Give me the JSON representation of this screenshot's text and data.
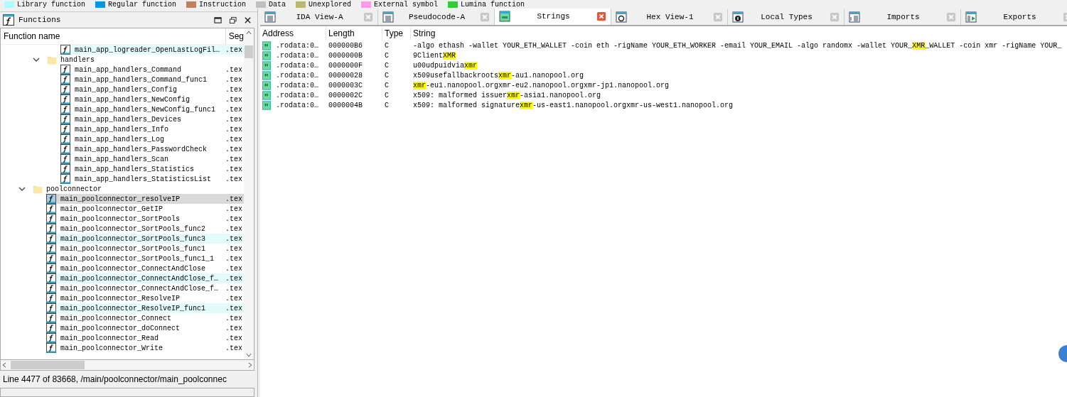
{
  "legend": [
    {
      "label": "Library function",
      "color": "#aaffff"
    },
    {
      "label": "Regular function",
      "color": "#0099dd"
    },
    {
      "label": "Instruction",
      "color": "#c08060"
    },
    {
      "label": "Data",
      "color": "#c0c0c0"
    },
    {
      "label": "Unexplored",
      "color": "#b8b870"
    },
    {
      "label": "External symbol",
      "color": "#ff99ee"
    },
    {
      "label": "Lumina function",
      "color": "#33cc33"
    }
  ],
  "functions_panel": {
    "title": "Functions",
    "columns": [
      "Function name",
      "Seg"
    ],
    "tree": [
      {
        "kind": "scrolled_folder",
        "children": [
          {
            "kind": "scrolled_folder",
            "children": [
              {
                "kind": "function",
                "name": "main_app_logreader_OpenLastLogFil…",
                "segment": ".tex",
                "highlighted": true,
                "selected": false
              }
            ]
          },
          {
            "kind": "folder",
            "name": "handlers",
            "expanded": true,
            "children": [
              {
                "kind": "function",
                "name": "main_app_handlers_Command",
                "segment": ".tex",
                "highlighted": false,
                "selected": false
              },
              {
                "kind": "function",
                "name": "main_app_handlers_Command_func1",
                "segment": ".tex",
                "highlighted": false,
                "selected": false
              },
              {
                "kind": "function",
                "name": "main_app_handlers_Config",
                "segment": ".tex",
                "highlighted": false,
                "selected": false
              },
              {
                "kind": "function",
                "name": "main_app_handlers_NewConfig",
                "segment": ".tex",
                "highlighted": false,
                "selected": false
              },
              {
                "kind": "function",
                "name": "main_app_handlers_NewConfig_func1",
                "segment": ".tex",
                "highlighted": false,
                "selected": false
              },
              {
                "kind": "function",
                "name": "main_app_handlers_Devices",
                "segment": ".tex",
                "highlighted": false,
                "selected": false
              },
              {
                "kind": "function",
                "name": "main_app_handlers_Info",
                "segment": ".tex",
                "highlighted": false,
                "selected": false
              },
              {
                "kind": "function",
                "name": "main_app_handlers_Log",
                "segment": ".tex",
                "highlighted": false,
                "selected": false
              },
              {
                "kind": "function",
                "name": "main_app_handlers_PasswordCheck",
                "segment": ".tex",
                "highlighted": false,
                "selected": false
              },
              {
                "kind": "function",
                "name": "main_app_handlers_Scan",
                "segment": ".tex",
                "highlighted": false,
                "selected": false
              },
              {
                "kind": "function",
                "name": "main_app_handlers_Statistics",
                "segment": ".tex",
                "highlighted": false,
                "selected": false
              },
              {
                "kind": "function",
                "name": "main_app_handlers_StatisticsList",
                "segment": ".tex",
                "highlighted": false,
                "selected": false
              }
            ]
          }
        ]
      },
      {
        "kind": "folder",
        "name": "poolconnector",
        "expanded": true,
        "children": [
          {
            "kind": "function",
            "name": "main_poolconnector_resolveIP",
            "segment": ".tex",
            "highlighted": false,
            "selected": true
          },
          {
            "kind": "function",
            "name": "main_poolconnector_GetIP",
            "segment": ".tex",
            "highlighted": false,
            "selected": false
          },
          {
            "kind": "function",
            "name": "main_poolconnector_SortPools",
            "segment": ".tex",
            "highlighted": false,
            "selected": false
          },
          {
            "kind": "function",
            "name": "main_poolconnector_SortPools_func2",
            "segment": ".tex",
            "highlighted": false,
            "selected": false
          },
          {
            "kind": "function",
            "name": "main_poolconnector_SortPools_func3",
            "segment": ".tex",
            "highlighted": true,
            "selected": false
          },
          {
            "kind": "function",
            "name": "main_poolconnector_SortPools_func1",
            "segment": ".tex",
            "highlighted": false,
            "selected": false
          },
          {
            "kind": "function",
            "name": "main_poolconnector_SortPools_func1_1",
            "segment": ".tex",
            "highlighted": false,
            "selected": false
          },
          {
            "kind": "function",
            "name": "main_poolconnector_ConnectAndClose",
            "segment": ".tex",
            "highlighted": false,
            "selected": false
          },
          {
            "kind": "function",
            "name": "main_poolconnector_ConnectAndClose_f…",
            "segment": ".tex",
            "highlighted": true,
            "selected": false
          },
          {
            "kind": "function",
            "name": "main_poolconnector_ConnectAndClose_f…",
            "segment": ".tex",
            "highlighted": false,
            "selected": false
          },
          {
            "kind": "function",
            "name": "main_poolconnector_ResolveIP",
            "segment": ".tex",
            "highlighted": false,
            "selected": false
          },
          {
            "kind": "function",
            "name": "main_poolconnector_ResolveIP_func1",
            "segment": ".tex",
            "highlighted": true,
            "selected": false
          },
          {
            "kind": "function",
            "name": "main_poolconnector_Connect",
            "segment": ".tex",
            "highlighted": false,
            "selected": false
          },
          {
            "kind": "function",
            "name": "main_poolconnector_doConnect",
            "segment": ".tex",
            "highlighted": false,
            "selected": false
          },
          {
            "kind": "function",
            "name": "main_poolconnector_Read",
            "segment": ".tex",
            "highlighted": false,
            "selected": false
          },
          {
            "kind": "function",
            "name": "main_poolconnector_Write",
            "segment": ".tex",
            "highlighted": false,
            "selected": false
          }
        ]
      }
    ],
    "status": "Line 4477 of 83668, /main/poolconnector/main_poolconnec"
  },
  "tabs": [
    {
      "label": "IDA View-A",
      "selected": false
    },
    {
      "label": "Pseudocode-A",
      "selected": false
    },
    {
      "label": "Strings",
      "selected": true
    },
    {
      "label": "Hex View-1",
      "selected": false
    },
    {
      "label": "Local Types",
      "selected": false
    },
    {
      "label": "Imports",
      "selected": false
    },
    {
      "label": "Exports",
      "selected": false
    }
  ],
  "strings_table": {
    "columns": [
      "Address",
      "Length",
      "Type",
      "String"
    ],
    "rows": [
      {
        "address": ".rodata:0…",
        "length": "000000B6",
        "type": "C",
        "string": [
          {
            "text": " -algo ethash -wallet YOUR_ETH_WALLET -coin eth -rigName YOUR_ETH_WORKER -email YOUR_EMAIL -algo randomx -wallet YOUR_",
            "highlighted": false
          },
          {
            "text": "XMR",
            "highlighted": true
          },
          {
            "text": "_WALLET -coin xmr -rigName YOUR_",
            "highlighted": false
          }
        ]
      },
      {
        "address": ".rodata:0…",
        "length": "0000000B",
        "type": "C",
        "string": [
          {
            "text": "9Client",
            "highlighted": false
          },
          {
            "text": "XMR",
            "highlighted": true
          }
        ]
      },
      {
        "address": ".rodata:0…",
        "length": "0000000F",
        "type": "C",
        "string": [
          {
            "text": "u00udpuidvia",
            "highlighted": false
          },
          {
            "text": "xmr",
            "highlighted": true
          }
        ]
      },
      {
        "address": ".rodata:0…",
        "length": "00000028",
        "type": "C",
        "string": [
          {
            "text": "x509usefallbackroots",
            "highlighted": false
          },
          {
            "text": "xmr",
            "highlighted": true
          },
          {
            "text": "-au1.nanopool.org",
            "highlighted": false
          }
        ]
      },
      {
        "address": ".rodata:0…",
        "length": "0000003C",
        "type": "C",
        "string": [
          {
            "text": "xmr",
            "highlighted": true
          },
          {
            "text": "-eu1.nanopool.orgxmr-eu2.nanopool.orgxmr-jp1.nanopool.org",
            "highlighted": false
          }
        ]
      },
      {
        "address": ".rodata:0…",
        "length": "0000002C",
        "type": "C",
        "string": [
          {
            "text": "x509: malformed issuer",
            "highlighted": false
          },
          {
            "text": "xmr",
            "highlighted": true
          },
          {
            "text": "-asia1.nanopool.org",
            "highlighted": false
          }
        ]
      },
      {
        "address": ".rodata:0…",
        "length": "0000004B",
        "type": "C",
        "string": [
          {
            "text": "x509: malformed signature",
            "highlighted": false
          },
          {
            "text": "xmr",
            "highlighted": true
          },
          {
            "text": "-us-east1.nanopool.orgxmr-us-west1.nanopool.org",
            "highlighted": false
          }
        ]
      }
    ]
  }
}
